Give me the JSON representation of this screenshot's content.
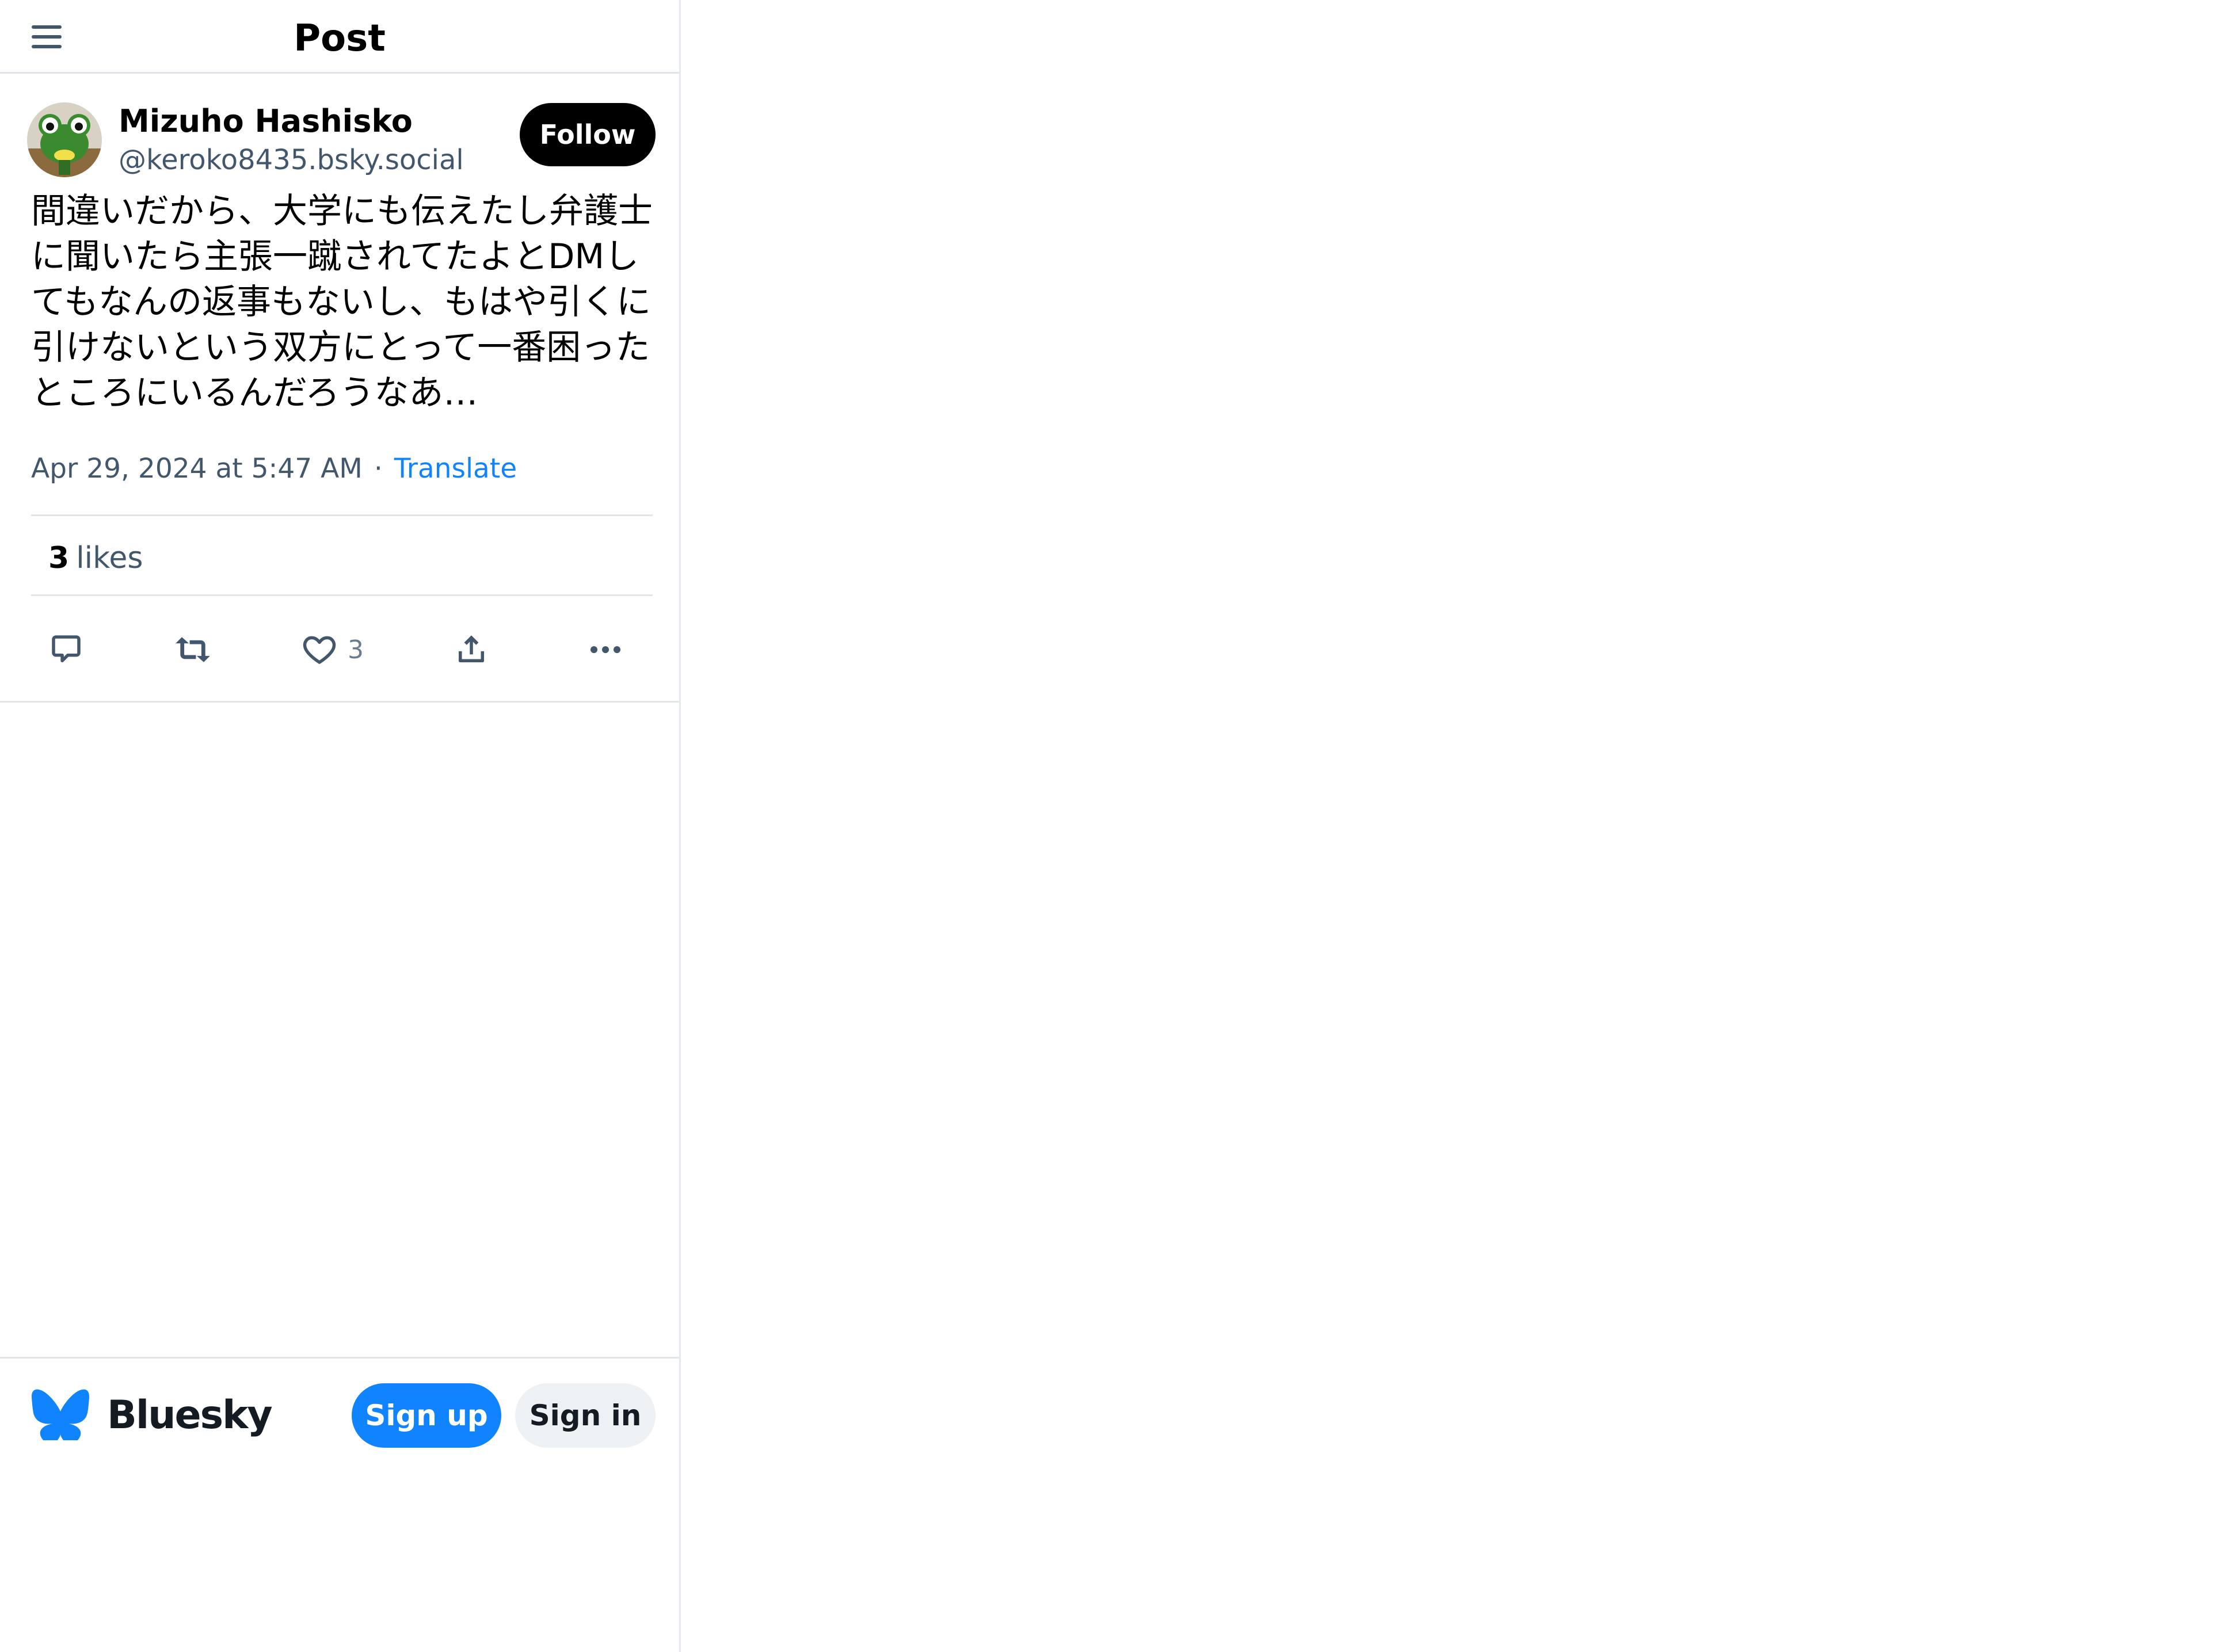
{
  "header": {
    "title": "Post",
    "menu_icon": "hamburger-menu-icon"
  },
  "post": {
    "author": {
      "display_name": "Mizuho Hashisko",
      "handle": "@keroko8435.bsky.social",
      "avatar_icon": "frog-avatar"
    },
    "follow_label": "Follow",
    "text": "間違いだから、大学にも伝えたし弁護士に聞いたら主張一蹴されてたよとDMしてもなんの返事もないし、もはや引くに引けないという双方にとって一番困ったところにいるんだろうなあ…",
    "timestamp": "Apr 29, 2024 at 5:47 AM",
    "separator": "·",
    "translate_label": "Translate",
    "likes_count": "3",
    "likes_label": "likes",
    "actions": {
      "reply_icon": "reply-icon",
      "repost_icon": "repost-icon",
      "like_icon": "heart-icon",
      "like_count": "3",
      "share_icon": "share-icon",
      "more_icon": "more-options-icon"
    }
  },
  "footer": {
    "brand": "Bluesky",
    "logo_icon": "butterfly-logo-icon",
    "signup_label": "Sign up",
    "signin_label": "Sign in"
  },
  "colors": {
    "accent": "#1083fe",
    "muted_text": "#42576c",
    "icon": "#42576c",
    "divider": "#e2e6ea",
    "follow_bg": "#000000",
    "signin_bg": "#eef1f4"
  }
}
